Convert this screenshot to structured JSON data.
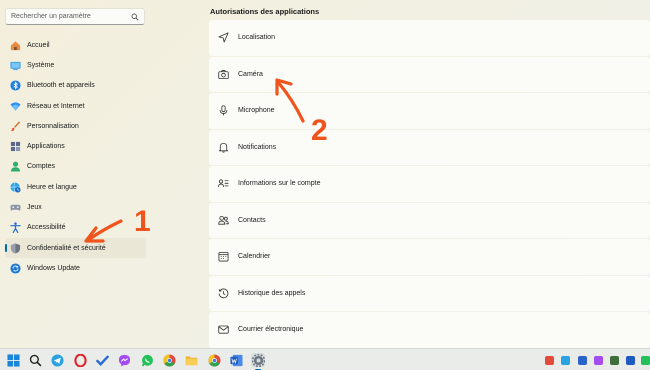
{
  "search": {
    "placeholder": "Rechercher un paramètre"
  },
  "sidebar": {
    "items": [
      {
        "label": "Accueil",
        "icon": "home-icon",
        "active": false
      },
      {
        "label": "Système",
        "icon": "system-icon",
        "active": false
      },
      {
        "label": "Bluetooth et appareils",
        "icon": "bluetooth-icon",
        "active": false
      },
      {
        "label": "Réseau et Internet",
        "icon": "wifi-icon",
        "active": false
      },
      {
        "label": "Personnalisation",
        "icon": "brush-icon",
        "active": false
      },
      {
        "label": "Applications",
        "icon": "apps-icon",
        "active": false
      },
      {
        "label": "Comptes",
        "icon": "account-icon",
        "active": false
      },
      {
        "label": "Heure et langue",
        "icon": "globe-clock-icon",
        "active": false
      },
      {
        "label": "Jeux",
        "icon": "gamepad-icon",
        "active": false
      },
      {
        "label": "Accessibilité",
        "icon": "accessibility-icon",
        "active": false
      },
      {
        "label": "Confidentialité et sécurité",
        "icon": "shield-icon",
        "active": true
      },
      {
        "label": "Windows Update",
        "icon": "update-icon",
        "active": false
      }
    ]
  },
  "main": {
    "section_title": "Autorisations des applications",
    "permissions": [
      {
        "label": "Localisation",
        "icon": "location-icon"
      },
      {
        "label": "Caméra",
        "icon": "camera-icon"
      },
      {
        "label": "Microphone",
        "icon": "microphone-icon"
      },
      {
        "label": "Notifications",
        "icon": "bell-icon"
      },
      {
        "label": "Informations sur le compte",
        "icon": "account-info-icon"
      },
      {
        "label": "Contacts",
        "icon": "contacts-icon"
      },
      {
        "label": "Calendrier",
        "icon": "calendar-icon"
      },
      {
        "label": "Historique des appels",
        "icon": "history-icon"
      },
      {
        "label": "Courrier électronique",
        "icon": "mail-icon"
      }
    ]
  },
  "annotations": {
    "label_1": "1",
    "label_2": "2",
    "color": "#f0541c"
  },
  "colors": {
    "accent": "#0067c0",
    "annotation": "#f0541c"
  }
}
